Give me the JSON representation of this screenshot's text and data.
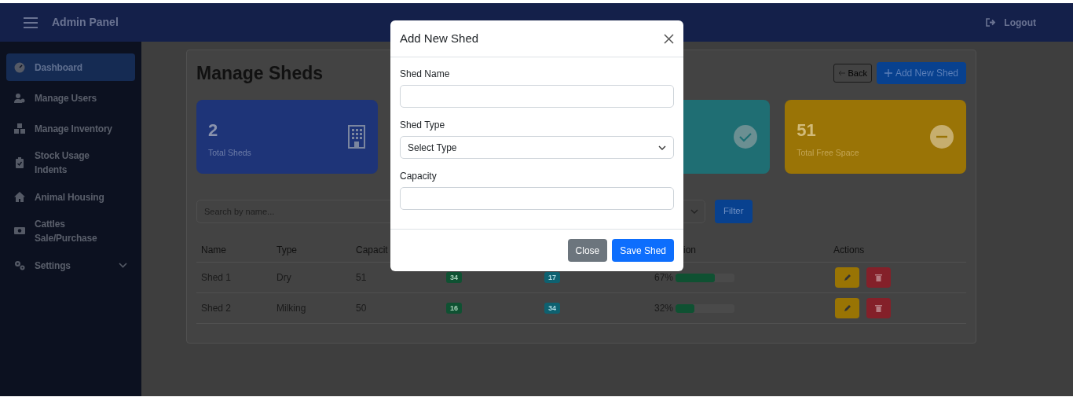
{
  "navbar": {
    "title": "Admin Panel",
    "logout": "Logout"
  },
  "sidebar": {
    "items": [
      {
        "label": "Dashboard",
        "selected": true,
        "kind": "link"
      },
      {
        "label": "Manage Users",
        "selected": false,
        "kind": "link"
      },
      {
        "label": "Manage Inventory",
        "selected": false,
        "kind": "link"
      },
      {
        "label": "Stock Usage Indents",
        "selected": false,
        "kind": "link"
      },
      {
        "label": "Animal Housing",
        "selected": false,
        "kind": "link"
      },
      {
        "label": "Cattles Sale/Purchase",
        "selected": false,
        "kind": "link"
      },
      {
        "label": "Settings",
        "selected": false,
        "kind": "group"
      }
    ]
  },
  "page": {
    "title": "Manage Sheds",
    "back_button": "Back",
    "add_button": "Add New Shed"
  },
  "stats": [
    {
      "value": "2",
      "label": "Total Sheds",
      "color": "#1e3478"
    },
    {
      "color": "#1f6e73"
    },
    {
      "value": "51",
      "label": "Total Free Space",
      "color": "#9a7406"
    }
  ],
  "filters": {
    "search_placeholder": "Search by name...",
    "filter_button": "Filter"
  },
  "table": {
    "columns": [
      {
        "label": "Name"
      },
      {
        "label": "Type"
      },
      {
        "label": "Capacit"
      },
      {
        "label": "ion"
      },
      {
        "label": "Actions"
      }
    ],
    "rows": [
      {
        "name": "Shed 1",
        "type": "Dry",
        "capacity": "51",
        "column_4": "34",
        "column_5": "17",
        "reading": "67%",
        "level": 0.67
      },
      {
        "name": "Shed 2",
        "type": "Milking",
        "capacity": "50",
        "column_4": "16",
        "column_5": "34",
        "reading": "32%",
        "level": 0.32
      }
    ]
  },
  "modal": {
    "title": "Add New Shed",
    "fields": [
      {
        "label": "Shed Name",
        "kind": "text"
      },
      {
        "label": "Shed Type",
        "kind": "select",
        "value": "Select Type"
      },
      {
        "label": "Capacity",
        "kind": "text"
      }
    ],
    "buttons": [
      {
        "label": "Close",
        "kind": "secondary"
      },
      {
        "label": "Save Shed",
        "kind": "primary"
      }
    ]
  }
}
